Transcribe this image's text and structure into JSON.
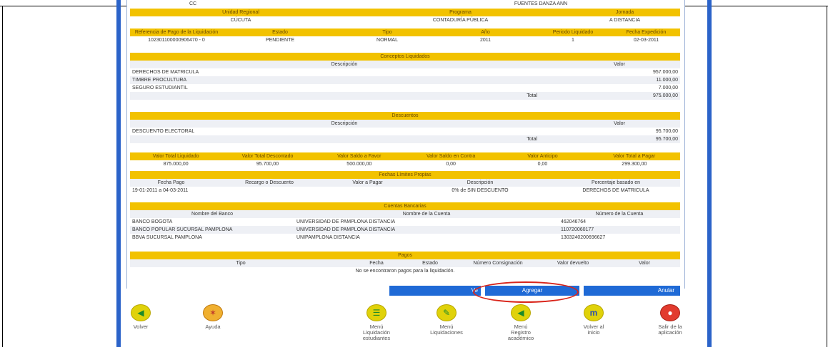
{
  "top_partial_row": [
    "CC",
    "FUENTES DANZA ANN"
  ],
  "header1": {
    "cols": [
      "Unidad Regional",
      "Programa",
      "Jornada"
    ],
    "values": [
      "CÚCUTA",
      "CONTADURÍA PÚBLICA",
      "A DISTANCIA"
    ]
  },
  "header2": {
    "cols": [
      "Referencia de Pago de la Liquidación",
      "Estado",
      "Tipo",
      "Año",
      "Periodo Liquidado",
      "Fecha Expedición"
    ],
    "values": [
      "102301100000906470 - 0",
      "PENDIENTE",
      "NORMAL",
      "2011",
      "1",
      "02-03-2011"
    ]
  },
  "conceptos": {
    "title": "Conceptos Liquidados",
    "col_desc": "Descripción",
    "col_valor": "Valor",
    "items": [
      {
        "desc": "DERECHOS DE MATRICULA",
        "valor": "957.000,00"
      },
      {
        "desc": "TIMBRE PROCULTURA",
        "valor": "11.000,00"
      },
      {
        "desc": "SEGURO ESTUDIANTIL",
        "valor": "7.000,00"
      }
    ],
    "total_label": "Total",
    "total_value": "975.000,00"
  },
  "descuentos": {
    "title": "Descuentos",
    "col_desc": "Descripción",
    "col_valor": "Valor",
    "items": [
      {
        "desc": "DESCUENTO ELECTORAL",
        "valor": "95.700,00"
      }
    ],
    "total_label": "Total",
    "total_value": "95.700,00"
  },
  "totales": {
    "cols": [
      "Valor Total Liquidado",
      "Valor Total Descontado",
      "Valor Saldo a Favor",
      "Valor Saldo en Contra",
      "Valor Anticipo",
      "Valor Total a Pagar"
    ],
    "values": [
      "875.000,00",
      "95.700,00",
      "500.000,00",
      "0,00",
      "0,00",
      "299.300,00"
    ]
  },
  "fechas": {
    "title": "Fechas Límites Propias",
    "cols": [
      "Fecha Pago",
      "Recargo o Descuento",
      "Valor a Pagar",
      "Descripción",
      "Porcentaje basado en"
    ],
    "row": [
      "19-01-2011 a 04-03-2011",
      "",
      "",
      "0% de SIN DESCUENTO",
      "DERECHOS DE MATRICULA"
    ]
  },
  "cuentas": {
    "title": "Cuentas Bancarias",
    "cols": [
      "Nombre del Banco",
      "Nombre de la Cuenta",
      "Número de la Cuenta"
    ],
    "rows": [
      [
        "BANCO BOGOTA",
        "UNIVERSIDAD DE PAMPLONA DISTANCIA",
        "462046764"
      ],
      [
        "BANCO POPULAR SUCURSAL PAMPLONA",
        "UNIVERSIDAD DE PAMPLONA DISTANCIA",
        "110720060177"
      ],
      [
        "BBVA SUCURSAL PAMPLONA",
        "UNIPAMPLONA DISTANCIA",
        "1303240200696627"
      ]
    ]
  },
  "pagos": {
    "title": "Pagos",
    "cols": [
      "Tipo",
      "Fecha",
      "Estado",
      "Número Consignación",
      "Valor devuelto",
      "Valor"
    ],
    "empty_msg": "No se encontraron pagos para la liquidación."
  },
  "actions": {
    "ver": "Ve",
    "agregar": "Agregar",
    "anular": "Anular"
  },
  "nav": [
    {
      "label": "Volver",
      "icon": "back-arrow-icon"
    },
    {
      "label": "Ayuda",
      "icon": "lifebuoy-icon"
    },
    {
      "label": "Menú Liquidación estudiantes",
      "icon": "menu-liquidacion-icon"
    },
    {
      "label": "Menú Liquidaciones",
      "icon": "menu-liquidaciones-icon"
    },
    {
      "label": "Menú Registro académico",
      "icon": "menu-registro-icon"
    },
    {
      "label": "Volver al inicio",
      "icon": "home-m-icon"
    },
    {
      "label": "Salir de la aplicación",
      "icon": "exit-icon"
    }
  ],
  "colors": {
    "header_yellow": "#f2c200",
    "action_blue": "#1f6ad6",
    "highlight_red": "#d9251b"
  }
}
